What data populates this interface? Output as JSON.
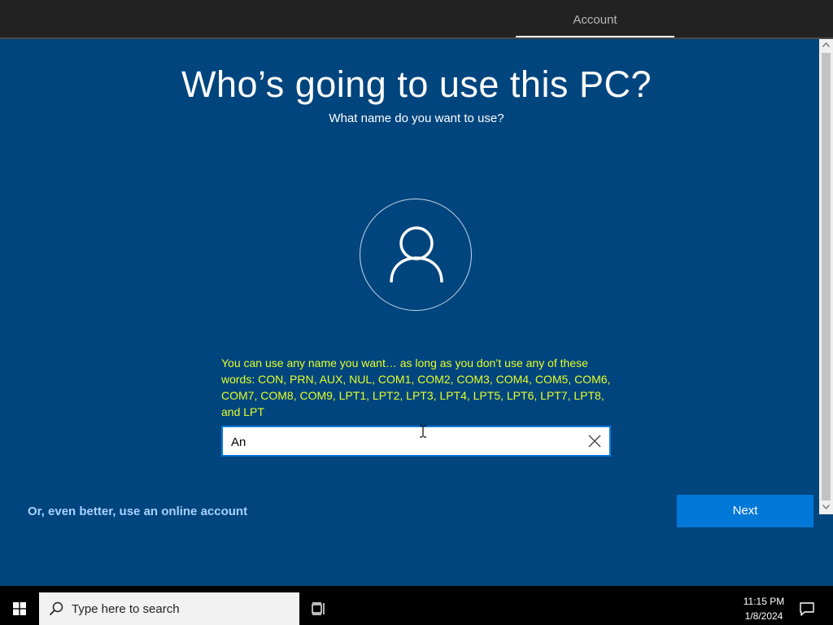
{
  "header": {
    "tab_label": "Account"
  },
  "page": {
    "title": "Who’s going to use this PC?",
    "subtitle": "What name do you want to use?",
    "warning": "You can use any name you want… as long as you don’t use any of these words: CON, PRN, AUX, NUL, COM1, COM2, COM3, COM4, COM5, COM6, COM7, COM8, COM9, LPT1, LPT2, LPT3, LPT4, LPT5, LPT6, LPT7, LPT8, and LPT"
  },
  "name_input": {
    "value": "An"
  },
  "actions": {
    "online_account_label": "Or, even better, use an online account",
    "next_label": "Next"
  },
  "taskbar": {
    "search_placeholder": "Type here to search",
    "time": "11:15 PM",
    "date": "1/8/2024"
  },
  "icons": {
    "start": "windows-logo-icon",
    "search": "magnifier-icon",
    "task_view": "task-view-icon",
    "notifications": "action-center-icon",
    "avatar": "person-icon",
    "clear": "close-icon"
  },
  "colors": {
    "background": "#00457e",
    "accent": "#0078d7",
    "warning_text": "#e6ff2a",
    "link": "#a8d2ff"
  }
}
